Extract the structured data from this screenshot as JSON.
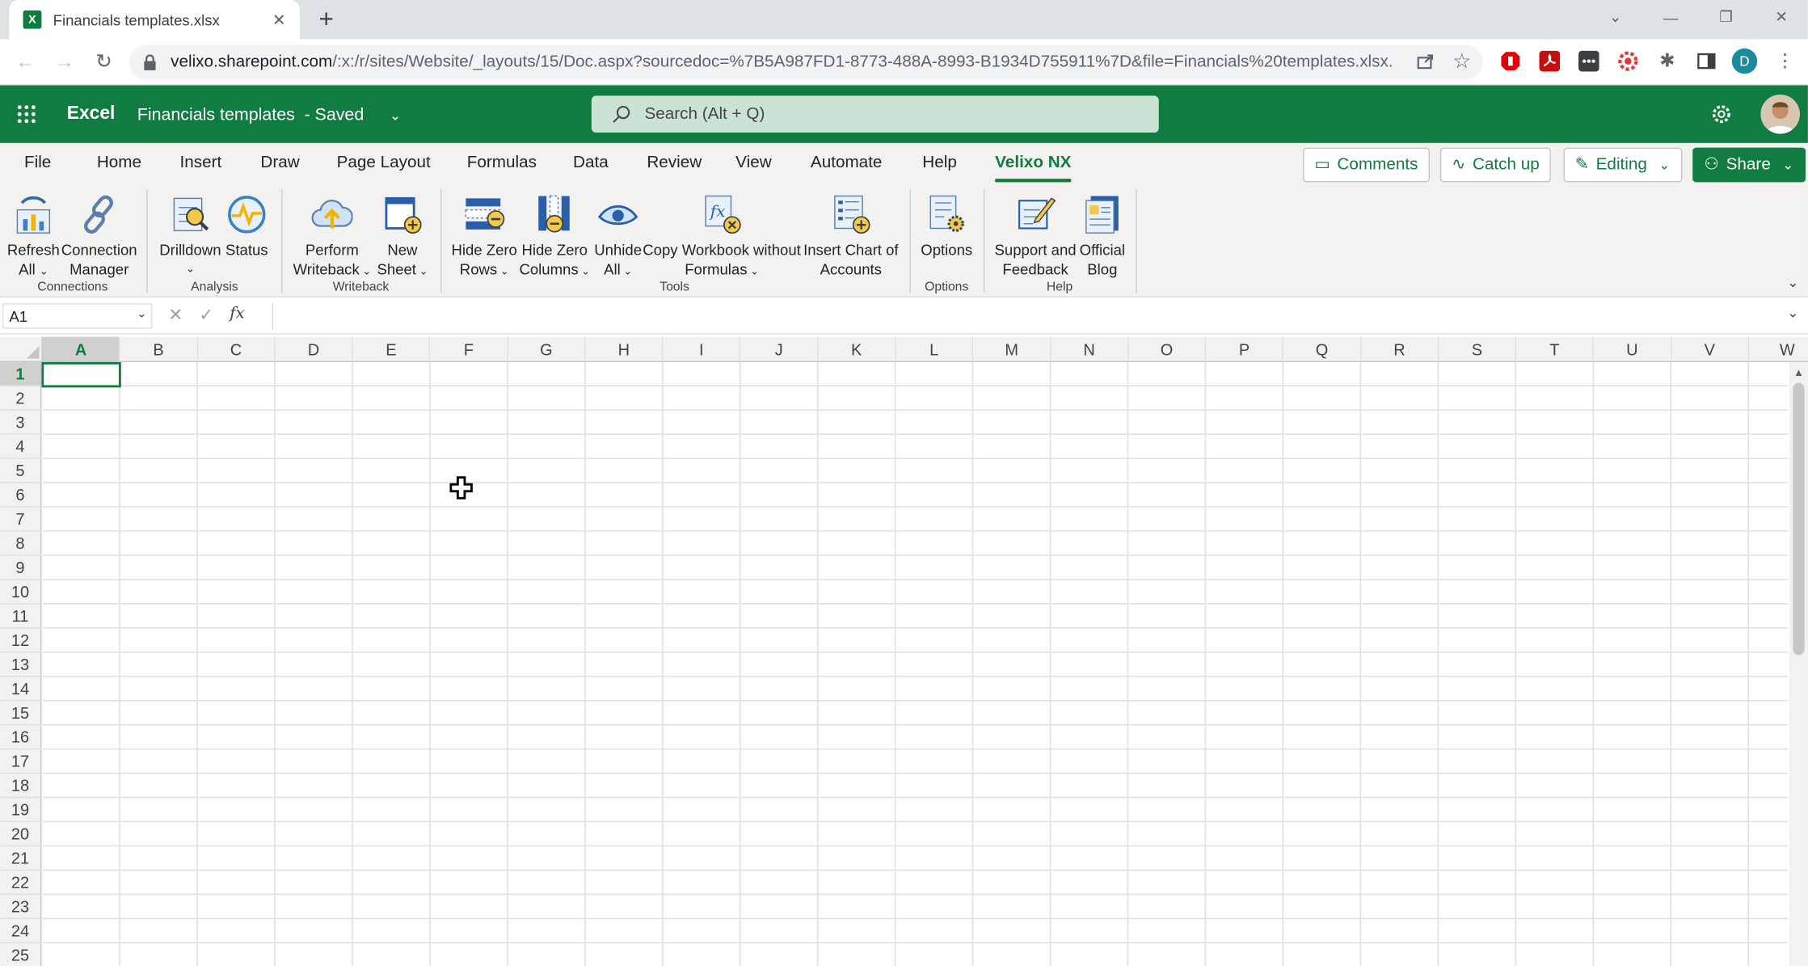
{
  "browser": {
    "tab_title": "Financials templates.xlsx",
    "url_main": "velixo.sharepoint.com",
    "url_rest": "/:x:/r/sites/Website/_layouts/15/Doc.aspx?sourcedoc=%7B5A987FD1-8773-488A-8993-B1934D755911%7D&file=Financials%20templates.xlsx...",
    "profile_initial": "D"
  },
  "app": {
    "name": "Excel",
    "doc_title": "Financials templates",
    "status": "-  Saved",
    "search_placeholder": "Search (Alt + Q)"
  },
  "ribbon_tabs": [
    "File",
    "Home",
    "Insert",
    "Draw",
    "Page Layout",
    "Formulas",
    "Data",
    "Review",
    "View",
    "Automate",
    "Help",
    "Velixo NX"
  ],
  "actions": {
    "comments": "Comments",
    "catch_up": "Catch up",
    "editing": "Editing",
    "share": "Share"
  },
  "commands": [
    {
      "l1": "Refresh",
      "l2": "All",
      "dd": true
    },
    {
      "l1": "Connection",
      "l2": "Manager",
      "dd": false
    },
    {
      "l1": "Drilldown",
      "l2": "",
      "dd": true
    },
    {
      "l1": "Status",
      "l2": "",
      "dd": false
    },
    {
      "l1": "Perform",
      "l2": "Writeback",
      "dd": true
    },
    {
      "l1": "New",
      "l2": "Sheet",
      "dd": true
    },
    {
      "l1": "Hide Zero",
      "l2": "Rows",
      "dd": true
    },
    {
      "l1": "Hide Zero",
      "l2": "Columns",
      "dd": true
    },
    {
      "l1": "Unhide",
      "l2": "All",
      "dd": true
    },
    {
      "l1": "Copy Workbook without",
      "l2": "Formulas",
      "dd": true
    },
    {
      "l1": "Insert Chart of",
      "l2": "Accounts",
      "dd": false
    },
    {
      "l1": "Options",
      "l2": "",
      "dd": false
    },
    {
      "l1": "Support and",
      "l2": "Feedback",
      "dd": false
    },
    {
      "l1": "Official",
      "l2": "Blog",
      "dd": false
    }
  ],
  "groups": [
    "Connections",
    "Analysis",
    "Writeback",
    "Tools",
    "Options",
    "Help"
  ],
  "formula_bar": {
    "name_box": "A1",
    "formula": ""
  },
  "columns": [
    "A",
    "B",
    "C",
    "D",
    "E",
    "F",
    "G",
    "H",
    "I",
    "J",
    "K",
    "L",
    "M",
    "N",
    "O",
    "P",
    "Q",
    "R",
    "S",
    "T",
    "U",
    "V",
    "W"
  ],
  "rows": [
    "1",
    "2",
    "3",
    "4",
    "5",
    "6",
    "7",
    "8",
    "9",
    "10",
    "11",
    "12",
    "13",
    "14",
    "15",
    "16",
    "17",
    "18",
    "19",
    "20",
    "21",
    "22",
    "23",
    "24",
    "25"
  ]
}
